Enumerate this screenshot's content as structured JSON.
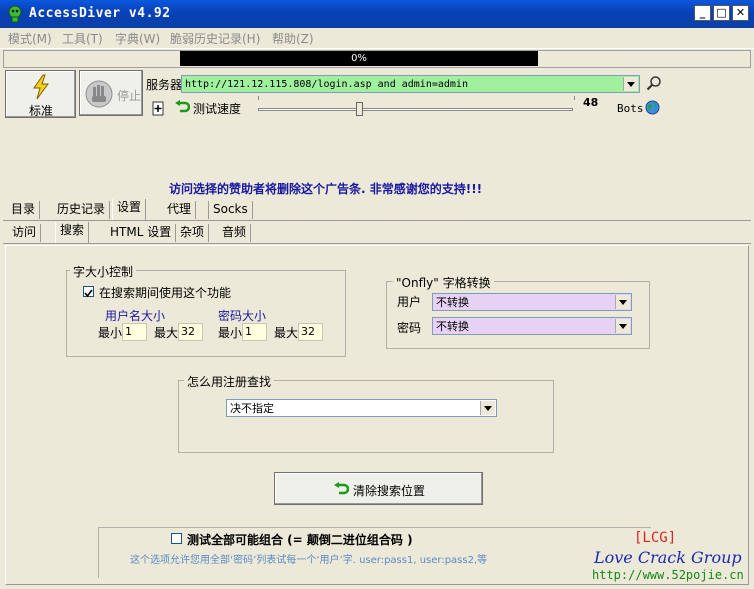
{
  "window": {
    "title": "AccessDiver v4.92",
    "minimize": "_",
    "maximize": "□",
    "close": "✕"
  },
  "menu": [
    "模式(M)",
    "工具(T)",
    "字典(W)",
    "脆弱历史记录(H)",
    "帮助(Z)"
  ],
  "progress": {
    "text": "0%",
    "value": 0
  },
  "toolbar": {
    "standard_label": "标准",
    "stop_label": "停止",
    "server_label": "服务器",
    "server_value": "http://121.12.115.808/login.asp and admin=admin",
    "speed_label": "测试速度",
    "speed_value": "48",
    "speed_fraction": 0.32,
    "bots_label": "Bots"
  },
  "banner": "访问选择的赞助者将删除这个广告条. 非常感谢您的支持!!!",
  "tabs_main": [
    "目录",
    "历史记录",
    "设置",
    "代理",
    "Socks"
  ],
  "tabs_sub": [
    "访问",
    "搜索",
    "HTML 设置",
    "杂项",
    "音频"
  ],
  "size_control": {
    "title": "字大小控制",
    "checkbox_label": "在搜索期间使用这个功能",
    "checked": true,
    "user_size_label": "用户名大小",
    "pass_size_label": "密码大小",
    "min_label": "最小",
    "max_label": "最大",
    "user_min": "1",
    "user_max": "32",
    "pass_min": "1",
    "pass_max": "32"
  },
  "onfly": {
    "title": "\"Onfly\" 字格转换",
    "user_label": "用户",
    "pass_label": "密码",
    "user_value": "不转换",
    "pass_value": "不转换"
  },
  "register": {
    "title": "怎么用注册查找",
    "value": "决不指定"
  },
  "clear_button": "清除搜索位置",
  "combo_test": {
    "checkbox_label": "测试全部可能组合 (= 颠倒二进位组合码 )",
    "checked": false,
    "description": "这个选项允许您用全部‘密码’列表试每一个‘用户’字. user:pass1, user:pass2,等"
  },
  "watermark": {
    "tag": "[LCG]",
    "name": "Love Crack Group",
    "url": "http://www.52pojie.cn"
  },
  "colors": {
    "titlebar": "#0a4fd0",
    "combo_purple": "#e6d2f5",
    "server_green": "#a0f0a0",
    "banner_blue": "#1a1aa0"
  }
}
